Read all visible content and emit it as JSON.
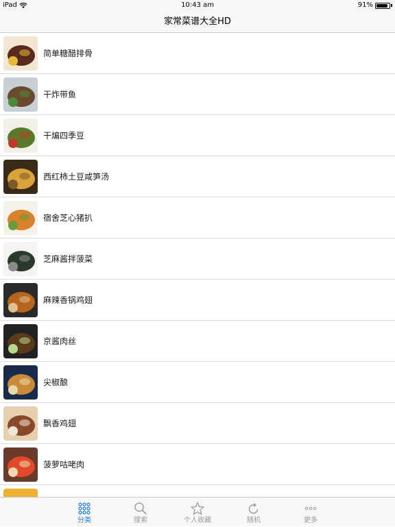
{
  "status_bar": {
    "carrier": "iPad",
    "time": "10:43 am",
    "battery_text": "91%",
    "battery_level": 0.91
  },
  "nav": {
    "title": "家常菜谱大全HD"
  },
  "recipes": [
    {
      "name": "简单糖醋排骨",
      "thumb_colors": [
        "#f3e7d3",
        "#5a2a1c",
        "#e6b93a"
      ]
    },
    {
      "name": "干炸带鱼",
      "thumb_colors": [
        "#c8d0d6",
        "#6b4a2f",
        "#4a8a3a"
      ]
    },
    {
      "name": "干煸四季豆",
      "thumb_colors": [
        "#f2f0e8",
        "#5a7a2a",
        "#c0392b"
      ]
    },
    {
      "name": "西红柿土豆咸笋汤",
      "thumb_colors": [
        "#3a2a18",
        "#d9a43a",
        "#7a5a2a"
      ]
    },
    {
      "name": "宿舍芝心猪扒",
      "thumb_colors": [
        "#f5f2ec",
        "#d9822b",
        "#6a9a3a"
      ]
    },
    {
      "name": "芝麻酱拌菠菜",
      "thumb_colors": [
        "#f4f4f2",
        "#2a3a2a",
        "#8a8a8a"
      ]
    },
    {
      "name": "麻辣香锅鸡翅",
      "thumb_colors": [
        "#2a2a2a",
        "#b5651d",
        "#e0c090"
      ]
    },
    {
      "name": "京酱肉丝",
      "thumb_colors": [
        "#222222",
        "#5a3a1a",
        "#b8d88a"
      ]
    },
    {
      "name": "尖椒酿",
      "thumb_colors": [
        "#1a2a4a",
        "#c98a3a",
        "#e8d8a8"
      ]
    },
    {
      "name": "飘香鸡翅",
      "thumb_colors": [
        "#e6d0b0",
        "#8a4a2a",
        "#f0e6d6"
      ]
    },
    {
      "name": "菠萝咕咾肉",
      "thumb_colors": [
        "#6a3a2a",
        "#e04a2a",
        "#f2d8b0"
      ]
    },
    {
      "name": "",
      "thumb_colors": [
        "#f0b030",
        "#d08a20",
        "#ffffff"
      ]
    }
  ],
  "tabs": [
    {
      "label": "分类",
      "icon": "grid-icon",
      "active": true
    },
    {
      "label": "搜索",
      "icon": "search-icon",
      "active": false
    },
    {
      "label": "个人收藏",
      "icon": "star-icon",
      "active": false
    },
    {
      "label": "随机",
      "icon": "refresh-icon",
      "active": false
    },
    {
      "label": "更多",
      "icon": "more-icon",
      "active": false
    }
  ],
  "colors": {
    "accent": "#1f7be0",
    "tab_inactive": "#9a9a9a",
    "bar_bg": "#f7f7f7"
  }
}
